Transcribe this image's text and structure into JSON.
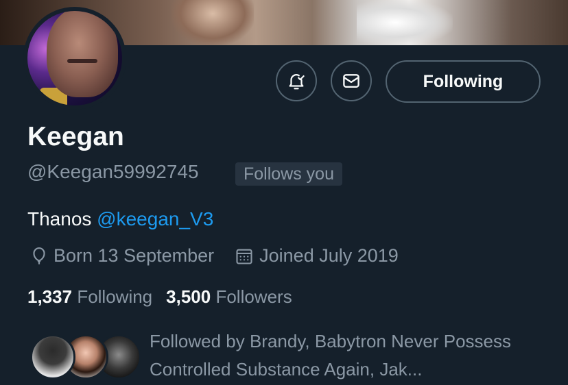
{
  "profile": {
    "display_name": "Keegan",
    "handle": "@Keegan59992745",
    "follows_you_badge": "Follows you",
    "bio_text": "Thanos ",
    "bio_mention": "@keegan_V3",
    "location": "Born 13 September",
    "joined": "Joined July 2019",
    "following_count": "1,337",
    "following_label": "Following",
    "followers_count": "3,500",
    "followers_label": "Followers",
    "followed_by_text": "Followed by Brandy, Babytron Never Possess Controlled Substance Again, Jak..."
  },
  "actions": {
    "notify_icon": "bell-check-icon",
    "message_icon": "envelope-icon",
    "following_button": "Following"
  },
  "colors": {
    "background": "#15202b",
    "primary_text": "#f7f9f9",
    "secondary_text": "#8b98a5",
    "link": "#1d9bf0",
    "border": "#536471"
  }
}
